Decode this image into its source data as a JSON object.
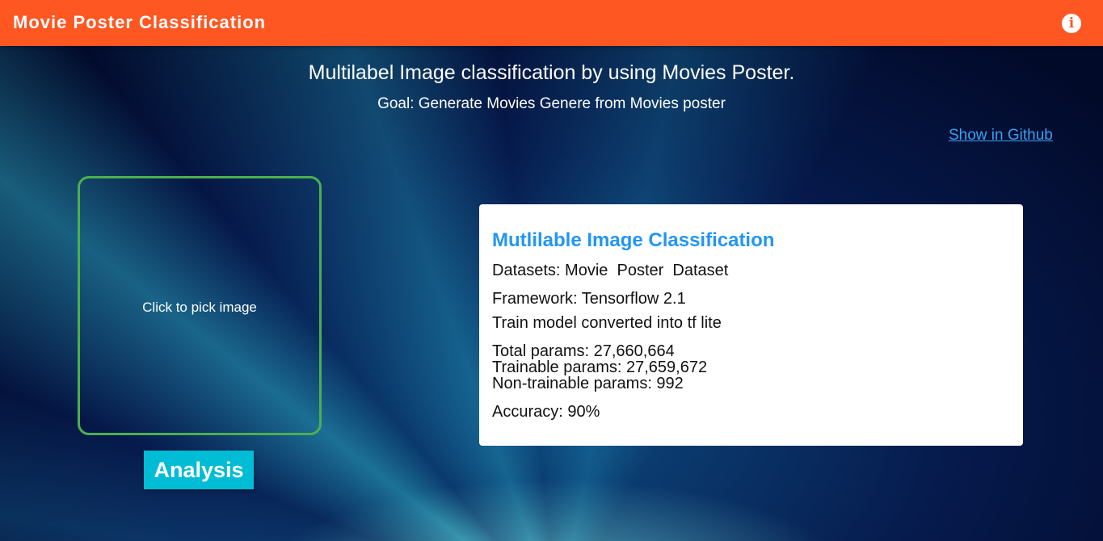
{
  "header": {
    "title": "Movie Poster Classification",
    "info_icon": "info-icon",
    "color": "#fe5722"
  },
  "intro": {
    "headline": "Multilabel Image classification by using Movies Poster.",
    "goal": "Goal: Generate Movies Genere from Movies poster",
    "github_link": "Show in Github"
  },
  "picker": {
    "label": "Click to pick image",
    "border_color": "#4caf50"
  },
  "analysis_button": {
    "label": "Analysis",
    "color": "#00bcd4"
  },
  "info_card": {
    "title": "Mutlilable Image Classification",
    "datasets": "Datasets: Movie  Poster  Dataset",
    "framework": "Framework: Tensorflow 2.1",
    "conversion": "Train model converted into tf lite",
    "total_params": "Total params: 27,660,664",
    "trainable_params": "Trainable params: 27,659,672",
    "non_trainable_params": "Non-trainable params: 992",
    "accuracy": "Accuracy: 90%",
    "title_color": "#2196f3"
  }
}
